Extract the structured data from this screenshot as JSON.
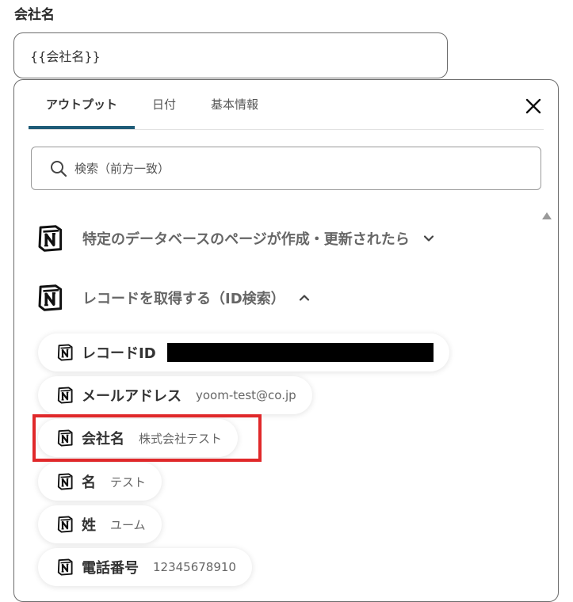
{
  "field": {
    "label": "会社名",
    "value": "{{会社名}}"
  },
  "panel": {
    "tabs": [
      {
        "label": "アウトプット",
        "active": true
      },
      {
        "label": "日付",
        "active": false
      },
      {
        "label": "基本情報",
        "active": false
      }
    ],
    "search": {
      "placeholder": "検索（前方一致）"
    },
    "sections": [
      {
        "title": "特定のデータベースのページが作成・更新されたら",
        "expanded": false,
        "icon": "notion-icon"
      },
      {
        "title": "レコードを取得する（ID検索）",
        "expanded": true,
        "icon": "notion-icon"
      }
    ],
    "items": [
      {
        "name": "レコードID",
        "value": "",
        "redacted": true
      },
      {
        "name": "メールアドレス",
        "value": "yoom-test@co.jp"
      },
      {
        "name": "会社名",
        "value": "株式会社テスト",
        "highlighted": true
      },
      {
        "name": "名",
        "value": "テスト"
      },
      {
        "name": "姓",
        "value": "ユーム"
      },
      {
        "name": "電話番号",
        "value": "12345678910"
      }
    ]
  },
  "colors": {
    "tab_underline": "#1e5c78",
    "highlight_border": "#e0282a",
    "redaction": "#000000"
  }
}
